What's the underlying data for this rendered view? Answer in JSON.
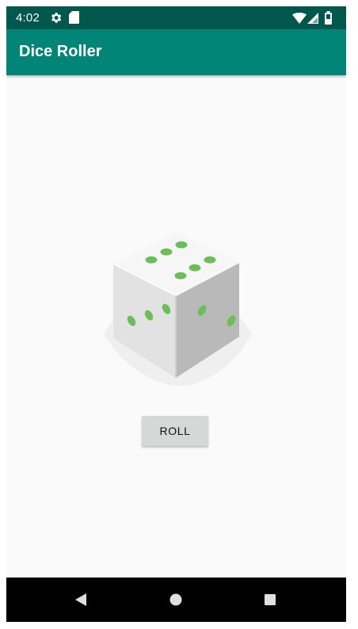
{
  "status_bar": {
    "time": "4:02",
    "icons": [
      "settings-gear-icon",
      "sd-card-icon",
      "wifi-icon",
      "cell-signal-icon",
      "battery-icon"
    ]
  },
  "app_bar": {
    "title": "Dice Roller"
  },
  "dice": {
    "image_name": "dice-six-icon",
    "pip_color": "#6dbd5b",
    "face_shown": 6
  },
  "roll_button": {
    "label": "ROLL"
  },
  "nav_bar": {
    "buttons": [
      "back-icon",
      "home-icon",
      "recents-icon"
    ]
  },
  "colors": {
    "primary": "#008577",
    "primary_dark": "#00574b",
    "background": "#fafafa",
    "button": "#d6d7d7"
  }
}
